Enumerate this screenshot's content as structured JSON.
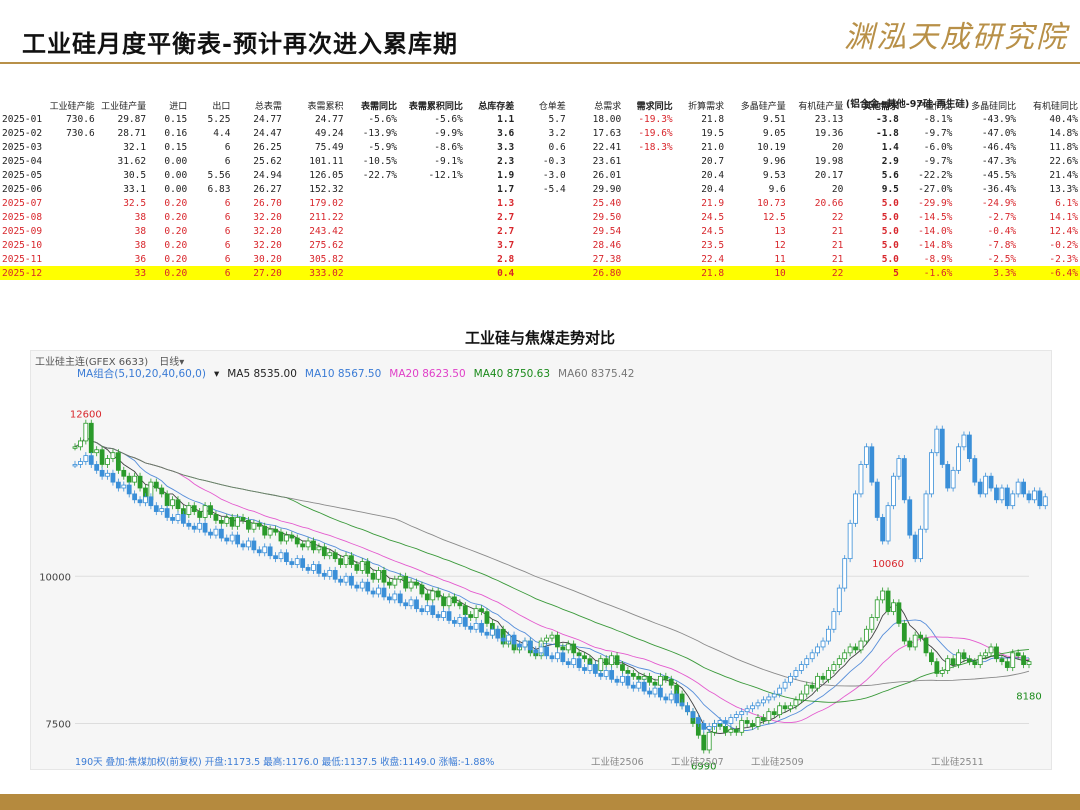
{
  "page": {
    "title": "工业硅月度平衡表-预计再次进入累库期",
    "brand": "渊泓天成研究院"
  },
  "table": {
    "group_note": "(铝合金+其他-97硅-再生硅)",
    "headers": [
      "",
      "工业硅产能",
      "工业硅产量",
      "进口",
      "出口",
      "总表需",
      "表需累积",
      "表需同比",
      "表需累积同比",
      "总库存差",
      "仓单差",
      "总需求",
      "需求同比",
      "折算需求",
      "多晶硅产量",
      "有机硅产量",
      "其他需求",
      "产量同比",
      "多晶硅同比",
      "有机硅同比"
    ],
    "bold_headers": [
      7,
      8,
      9,
      12,
      16
    ],
    "rows": [
      {
        "style": "normal",
        "cells": [
          "2025-01",
          "730.6",
          "29.87",
          "0.15",
          "5.25",
          "24.77",
          "24.77",
          "-5.6%",
          "-5.6%",
          "1.1",
          "5.7",
          "18.00",
          "-19.3%",
          "21.8",
          "9.51",
          "23.13",
          "-3.8",
          "-8.1%",
          "-43.9%",
          "40.4%"
        ]
      },
      {
        "style": "normal",
        "cells": [
          "2025-02",
          "730.6",
          "28.71",
          "0.16",
          "4.4",
          "24.47",
          "49.24",
          "-13.9%",
          "-9.9%",
          "3.6",
          "3.2",
          "17.63",
          "-19.6%",
          "19.5",
          "9.05",
          "19.36",
          "-1.8",
          "-9.7%",
          "-47.0%",
          "14.8%"
        ]
      },
      {
        "style": "normal",
        "cells": [
          "2025-03",
          "",
          "32.1",
          "0.15",
          "6",
          "26.25",
          "75.49",
          "-5.9%",
          "-8.6%",
          "3.3",
          "0.6",
          "22.41",
          "-18.3%",
          "21.0",
          "10.19",
          "20",
          "1.4",
          "-6.0%",
          "-46.4%",
          "11.8%"
        ]
      },
      {
        "style": "normal",
        "cells": [
          "2025-04",
          "",
          "31.62",
          "0.00",
          "6",
          "25.62",
          "101.11",
          "-10.5%",
          "-9.1%",
          "2.3",
          "-0.3",
          "23.61",
          "",
          "20.7",
          "9.96",
          "19.98",
          "2.9",
          "-9.7%",
          "-47.3%",
          "22.6%"
        ]
      },
      {
        "style": "normal",
        "cells": [
          "2025-05",
          "",
          "30.5",
          "0.00",
          "5.56",
          "24.94",
          "126.05",
          "-22.7%",
          "-12.1%",
          "1.9",
          "-3.0",
          "26.01",
          "",
          "20.4",
          "9.53",
          "20.17",
          "5.6",
          "-22.2%",
          "-45.5%",
          "21.4%"
        ]
      },
      {
        "style": "normal",
        "cells": [
          "2025-06",
          "",
          "33.1",
          "0.00",
          "6.83",
          "26.27",
          "152.32",
          "",
          "",
          "1.7",
          "-5.4",
          "29.90",
          "",
          "20.4",
          "9.6",
          "20",
          "9.5",
          "-27.0%",
          "-36.4%",
          "13.3%"
        ]
      },
      {
        "style": "red",
        "cells": [
          "2025-07",
          "",
          "32.5",
          "0.20",
          "6",
          "26.70",
          "179.02",
          "",
          "",
          "1.3",
          "",
          "25.40",
          "",
          "21.9",
          "10.73",
          "20.66",
          "5.0",
          "-29.9%",
          "-24.9%",
          "6.1%"
        ]
      },
      {
        "style": "red",
        "cells": [
          "2025-08",
          "",
          "38",
          "0.20",
          "6",
          "32.20",
          "211.22",
          "",
          "",
          "2.7",
          "",
          "29.50",
          "",
          "24.5",
          "12.5",
          "22",
          "5.0",
          "-14.5%",
          "-2.7%",
          "14.1%"
        ]
      },
      {
        "style": "red",
        "cells": [
          "2025-09",
          "",
          "38",
          "0.20",
          "6",
          "32.20",
          "243.42",
          "",
          "",
          "2.7",
          "",
          "29.54",
          "",
          "24.5",
          "13",
          "21",
          "5.0",
          "-14.0%",
          "-0.4%",
          "12.4%"
        ]
      },
      {
        "style": "red",
        "cells": [
          "2025-10",
          "",
          "38",
          "0.20",
          "6",
          "32.20",
          "275.62",
          "",
          "",
          "3.7",
          "",
          "28.46",
          "",
          "23.5",
          "12",
          "21",
          "5.0",
          "-14.8%",
          "-7.8%",
          "-0.2%"
        ]
      },
      {
        "style": "red",
        "cells": [
          "2025-11",
          "",
          "36",
          "0.20",
          "6",
          "30.20",
          "305.82",
          "",
          "",
          "2.8",
          "",
          "27.38",
          "",
          "22.4",
          "11",
          "21",
          "5.0",
          "-8.9%",
          "-2.5%",
          "-2.3%"
        ]
      },
      {
        "style": "hl",
        "cells": [
          "2025-12",
          "",
          "33",
          "0.20",
          "6",
          "27.20",
          "333.02",
          "",
          "",
          "0.4",
          "",
          "26.80",
          "",
          "21.8",
          "10",
          "22",
          "5",
          "-1.6%",
          "3.3%",
          "-6.4%"
        ]
      }
    ]
  },
  "chart_header": {
    "instrument": "工业硅主连(GFEX 6633)",
    "period": "日线",
    "ma_group": "MA组合(5,10,20,40,60,0)",
    "ma": [
      {
        "label": "MA5 8535.00",
        "color": "#222222"
      },
      {
        "label": "MA10 8567.50",
        "color": "#3a7bd5"
      },
      {
        "label": "MA20 8623.50",
        "color": "#e040c8"
      },
      {
        "label": "MA40 8750.63",
        "color": "#1a8a1a"
      },
      {
        "label": "MA60 8375.42",
        "color": "#777777"
      }
    ],
    "footer": "190天 叠加:焦煤加权(前复权) 开盘:1173.5 最高:1176.0 最低:1137.5 收盘:1149.0 涨幅:-1.88%",
    "footer_color": "#3a7bd5",
    "contract_labels": [
      "工业硅2506",
      "工业硅2507",
      "工业硅2509",
      "工业硅2511"
    ]
  },
  "chart_data": {
    "type": "line",
    "title": "工业硅与焦煤走势对比",
    "y_ticks": [
      10000,
      7500
    ],
    "ylim": [
      7100,
      13250
    ],
    "annotations": [
      {
        "text": "12600",
        "index": 2,
        "value": 12600,
        "color": "#d8262c"
      },
      {
        "text": "10060",
        "index": 150,
        "value": 10060,
        "color": "#d8262c"
      },
      {
        "text": "6990",
        "index": 116,
        "value": 6990,
        "color": "#1a8a1a"
      },
      {
        "text": "8180",
        "index": 176,
        "value": 8180,
        "color": "#1a8a1a"
      }
    ],
    "series": [
      {
        "name": "工业硅主连",
        "color": "#2a9a2a",
        "values": [
          12200,
          12300,
          12600,
          12100,
          12150,
          11900,
          12000,
          12100,
          11800,
          11700,
          11600,
          11700,
          11500,
          11300,
          11600,
          11500,
          11400,
          11200,
          11300,
          11150,
          11050,
          11200,
          11100,
          11000,
          11200,
          11050,
          10950,
          10900,
          11000,
          10850,
          11000,
          10950,
          10800,
          10900,
          10850,
          10700,
          10800,
          10750,
          10600,
          10700,
          10650,
          10550,
          10500,
          10600,
          10450,
          10500,
          10350,
          10400,
          10300,
          10200,
          10350,
          10200,
          10100,
          10250,
          10050,
          9950,
          10100,
          9900,
          9850,
          9950,
          10000,
          9800,
          9900,
          9850,
          9700,
          9600,
          9750,
          9650,
          9500,
          9650,
          9550,
          9500,
          9350,
          9300,
          9450,
          9400,
          9200,
          9000,
          9100,
          8850,
          8950,
          8750,
          8800,
          8900,
          8700,
          8650,
          8900,
          8950,
          9000,
          8800,
          8750,
          8850,
          8700,
          8650,
          8600,
          8500,
          8400,
          8600,
          8500,
          8650,
          8500,
          8400,
          8350,
          8300,
          8250,
          8300,
          8200,
          8150,
          8300,
          8250,
          8150,
          8000,
          7800,
          7700,
          7500,
          7300,
          7050,
          7350,
          7500,
          7450,
          7350,
          7400,
          7350,
          7550,
          7500,
          7450,
          7600,
          7550,
          7700,
          7650,
          7800,
          7750,
          7800,
          7900,
          8000,
          8150,
          8100,
          8300,
          8250,
          8400,
          8500,
          8600,
          8700,
          8800,
          8750,
          8900,
          9100,
          9300,
          9600,
          9750,
          9400,
          9550,
          9200,
          8900,
          8800,
          9000,
          8950,
          8700,
          8550,
          8350,
          8400,
          8600,
          8500,
          8700,
          8600,
          8550,
          8500,
          8650,
          8700,
          8800,
          8600,
          8550,
          8450,
          8700,
          8650,
          8500,
          8550
        ]
      },
      {
        "name": "焦煤加权",
        "color": "#3a8fd8",
        "values": [
          11900,
          11950,
          12050,
          11900,
          11800,
          11700,
          11750,
          11600,
          11500,
          11550,
          11400,
          11300,
          11250,
          11350,
          11200,
          11100,
          11150,
          11000,
          10950,
          11050,
          10900,
          10850,
          10800,
          10900,
          10750,
          10700,
          10800,
          10650,
          10600,
          10700,
          10550,
          10500,
          10600,
          10450,
          10400,
          10500,
          10350,
          10300,
          10400,
          10250,
          10200,
          10300,
          10150,
          10100,
          10200,
          10050,
          10000,
          10100,
          9950,
          9900,
          10000,
          9850,
          9800,
          9900,
          9750,
          9700,
          9800,
          9650,
          9600,
          9700,
          9550,
          9500,
          9600,
          9450,
          9400,
          9500,
          9350,
          9300,
          9400,
          9250,
          9200,
          9300,
          9150,
          9100,
          9200,
          9050,
          9000,
          9100,
          8950,
          8900,
          9000,
          8850,
          8800,
          8900,
          8750,
          8700,
          8800,
          8650,
          8600,
          8700,
          8550,
          8500,
          8600,
          8450,
          8400,
          8500,
          8350,
          8300,
          8400,
          8250,
          8200,
          8300,
          8150,
          8100,
          8200,
          8050,
          8000,
          8100,
          7950,
          7900,
          8000,
          7850,
          7800,
          7700,
          7600,
          7500,
          7400,
          7450,
          7500,
          7550,
          7500,
          7600,
          7650,
          7700,
          7750,
          7800,
          7850,
          7900,
          7950,
          8000,
          8100,
          8200,
          8300,
          8400,
          8500,
          8600,
          8700,
          8800,
          8900,
          9100,
          9400,
          9800,
          10300,
          10900,
          11400,
          11900,
          12200,
          11600,
          11000,
          10600,
          11200,
          11700,
          12000,
          11300,
          10700,
          10300,
          10800,
          11400,
          12100,
          12500,
          11900,
          11500,
          11800,
          12200,
          12400,
          12000,
          11600,
          11400,
          11700,
          11500,
          11300,
          11500,
          11200,
          11400,
          11600,
          11400,
          11300,
          11450,
          11200,
          11350
        ]
      }
    ]
  }
}
